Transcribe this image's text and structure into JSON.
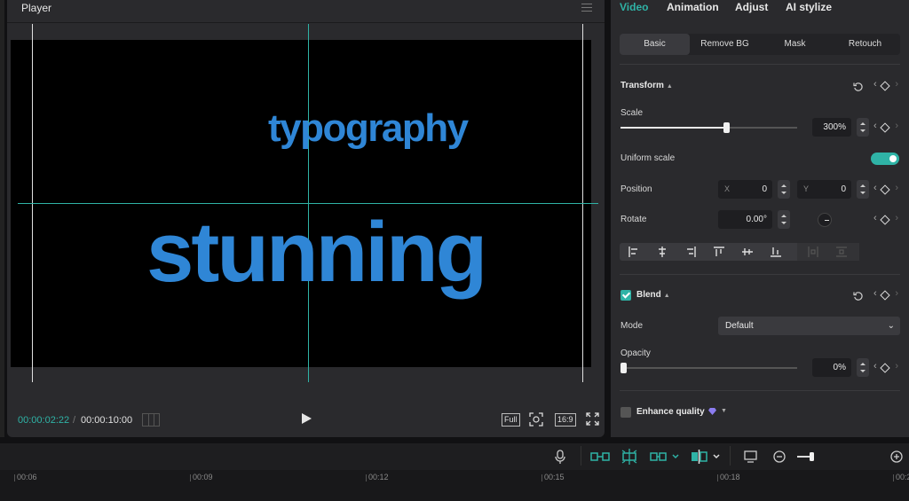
{
  "player": {
    "title": "Player",
    "canvas_text": {
      "line1": "typography",
      "line2": "stunning"
    },
    "time_current": "00:00:02:22",
    "time_separator": "/",
    "time_total": "00:00:10:00",
    "full_label": "Full",
    "ratio_label": "16:9"
  },
  "props": {
    "tabs": [
      {
        "label": "Video",
        "active": true
      },
      {
        "label": "Animation"
      },
      {
        "label": "Adjust"
      },
      {
        "label": "AI stylize"
      }
    ],
    "subtabs": [
      {
        "label": "Basic",
        "active": true
      },
      {
        "label": "Remove BG"
      },
      {
        "label": "Mask"
      },
      {
        "label": "Retouch"
      }
    ],
    "transform": {
      "title": "Transform",
      "scale_label": "Scale",
      "scale_value": "300%",
      "scale_fraction": 0.6,
      "uniform_label": "Uniform scale",
      "uniform_on": true,
      "position_label": "Position",
      "x_axis": "X",
      "x_value": "0",
      "y_axis": "Y",
      "y_value": "0",
      "rotate_label": "Rotate",
      "rotate_value": "0.00°"
    },
    "blend": {
      "title": "Blend",
      "checked": true,
      "mode_label": "Mode",
      "mode_value": "Default",
      "opacity_label": "Opacity",
      "opacity_value": "0%",
      "opacity_fraction": 0.0
    },
    "enhance": {
      "title": "Enhance quality",
      "checked": false
    }
  },
  "timeline": {
    "ticks": [
      "00:06",
      "00:09",
      "00:12",
      "00:15",
      "00:18",
      "00:2"
    ]
  },
  "colors": {
    "accent": "#2fb3a6",
    "text_blue": "#2f86d6",
    "panel": "#2a2a2d",
    "background": "#111113"
  }
}
